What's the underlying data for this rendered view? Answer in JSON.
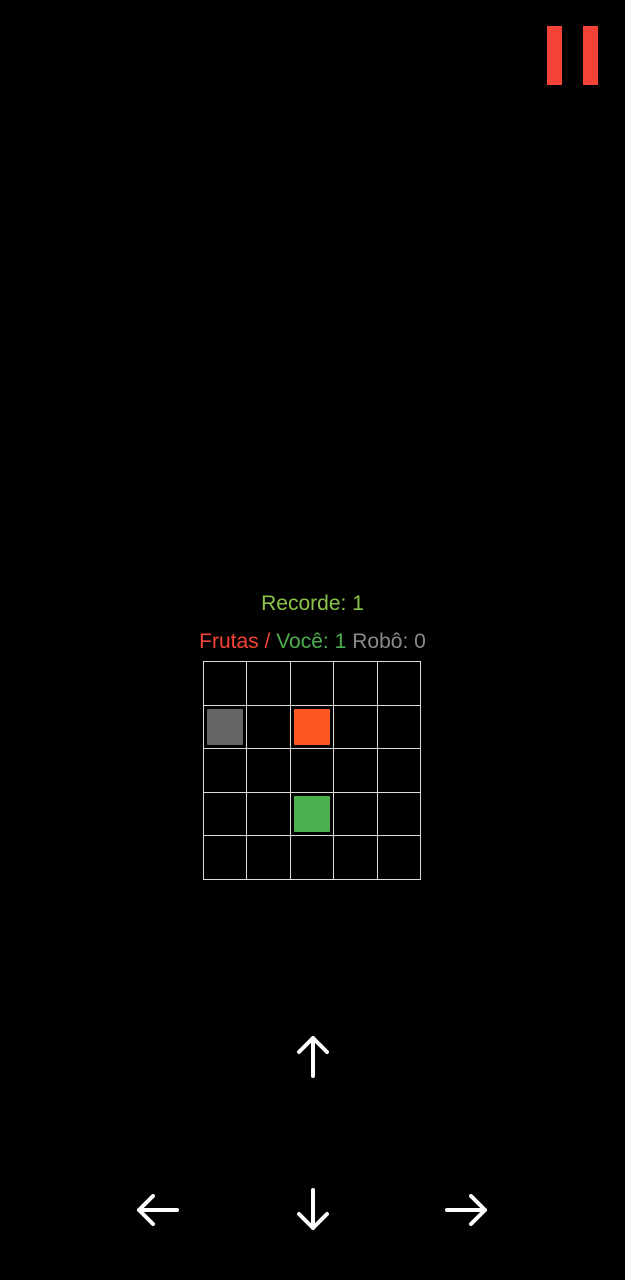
{
  "pause": {
    "icon": "pause-icon",
    "color": "#f44336"
  },
  "record": {
    "label": "Recorde:",
    "value": "1"
  },
  "score": {
    "fruits_label": "Frutas /",
    "you_label": "Você:",
    "you_value": "1",
    "robot_label": "Robô:",
    "robot_value": "0"
  },
  "board": {
    "rows": 5,
    "cols": 5,
    "pieces": [
      {
        "name": "robot-piece",
        "row": 1,
        "col": 0,
        "color": "#666666"
      },
      {
        "name": "fruit-piece",
        "row": 1,
        "col": 2,
        "color": "#ff5722"
      },
      {
        "name": "player-piece",
        "row": 3,
        "col": 2,
        "color": "#4caf50"
      }
    ]
  },
  "controls": {
    "up": "arrow-up-icon",
    "left": "arrow-left-icon",
    "down": "arrow-down-icon",
    "right": "arrow-right-icon"
  }
}
